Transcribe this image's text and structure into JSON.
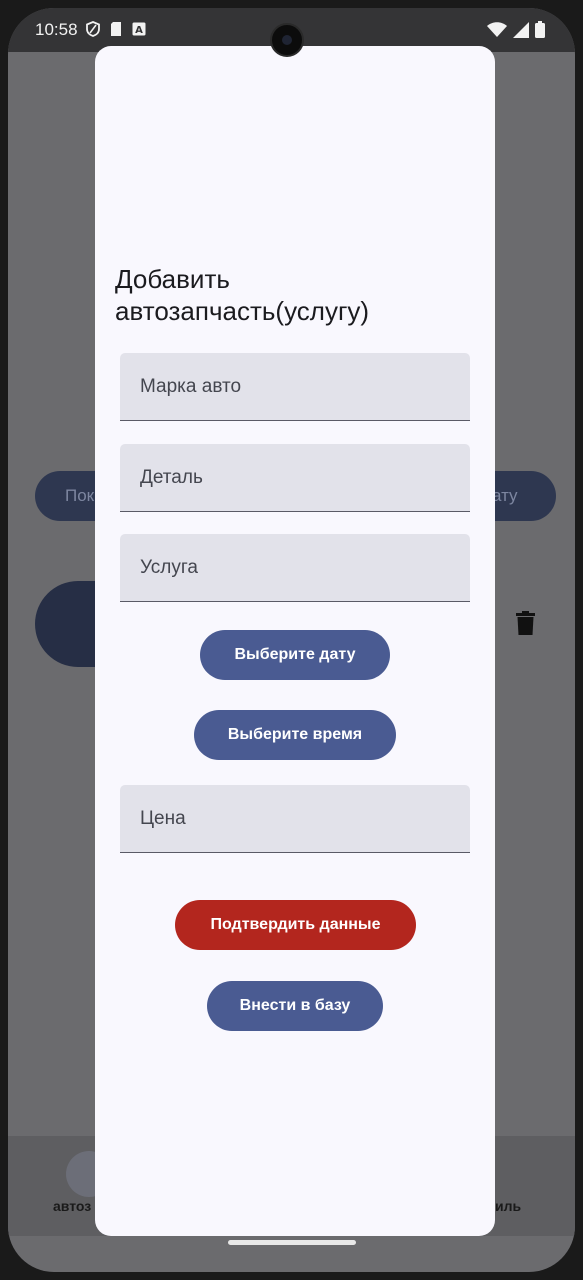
{
  "status_bar": {
    "time": "10:58"
  },
  "background": {
    "left_pill_label": "Пок",
    "right_pill_label": "ату",
    "nav_left_label": "автоз",
    "nav_right_label": "иль"
  },
  "dialog": {
    "title": "Добавить автозапчасть(услугу)",
    "fields": {
      "car_brand_placeholder": "Марка авто",
      "part_placeholder": "Деталь",
      "service_placeholder": "Услуга",
      "price_placeholder": "Цена"
    },
    "buttons": {
      "choose_date": "Выберите дату",
      "choose_time": "Выберите время",
      "confirm_data": "Подтвердить данные",
      "add_to_db": "Внести в базу"
    }
  },
  "colors": {
    "primary": "#4a5b92",
    "danger": "#b3261e",
    "dialog_bg": "#f9f8fe",
    "field_bg": "#e2e2ea"
  }
}
